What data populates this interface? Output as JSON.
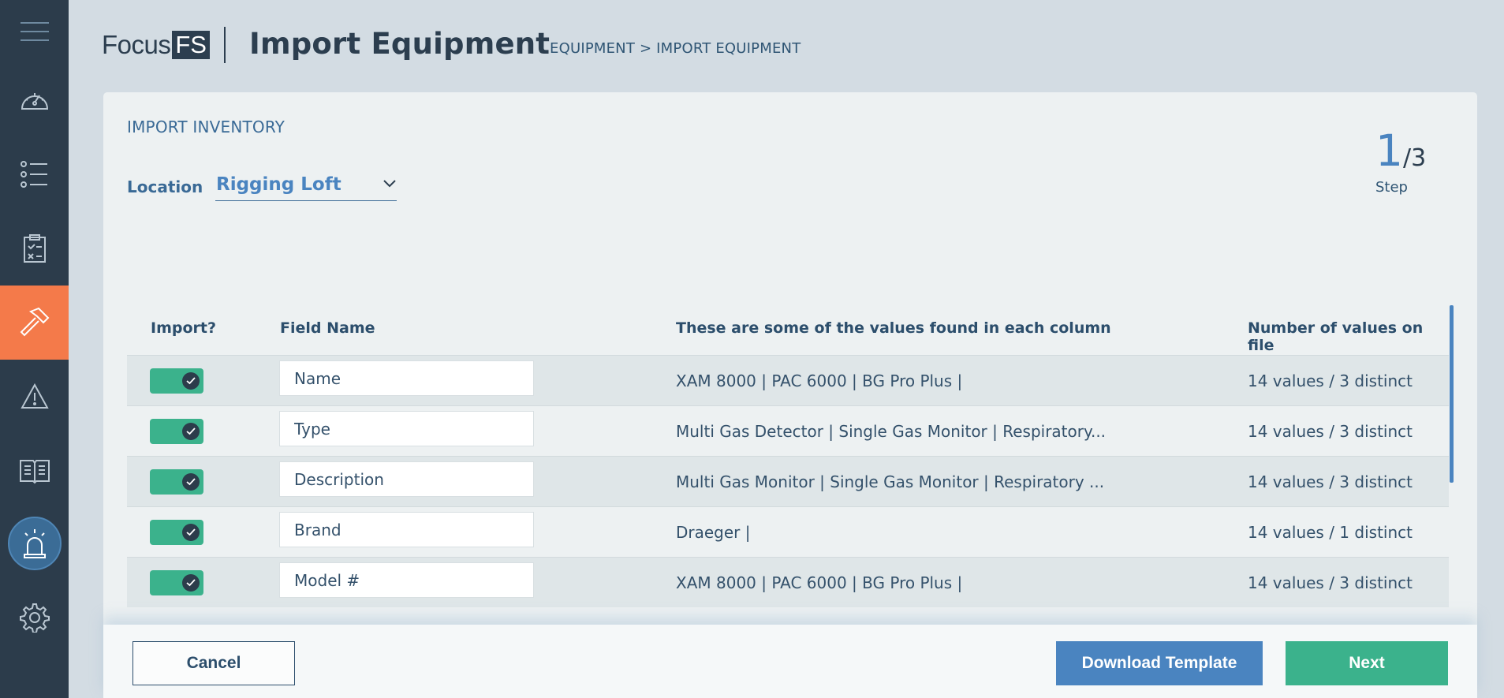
{
  "brand": {
    "focus": "Focus",
    "fs": "FS"
  },
  "header": {
    "title": "Import Equipment",
    "breadcrumb": "EQUIPMENT > IMPORT EQUIPMENT"
  },
  "sidebar": {
    "items": [
      {
        "icon": "menu-icon"
      },
      {
        "icon": "dashboard-gauge-icon"
      },
      {
        "icon": "list-icon"
      },
      {
        "icon": "checklist-clipboard-icon"
      },
      {
        "icon": "hammer-icon",
        "active": true
      },
      {
        "icon": "warning-icon"
      },
      {
        "icon": "manual-book-icon"
      },
      {
        "icon": "alarm-siren-icon"
      },
      {
        "icon": "gear-icon"
      }
    ],
    "active_color": "#f47a4a"
  },
  "section": {
    "title": "IMPORT INVENTORY",
    "location_label": "Location",
    "location_value": "Rigging Loft"
  },
  "step": {
    "current": "1",
    "total": "/3",
    "label": "Step"
  },
  "table": {
    "headers": {
      "import": "Import?",
      "field_name": "Field Name",
      "values": "These are some of the values found in each column",
      "count": "Number of values on file"
    },
    "rows": [
      {
        "import": true,
        "field": "Name",
        "values": "XAM 8000 | PAC 6000 | BG Pro Plus |",
        "count": "14 values / 3 distinct"
      },
      {
        "import": true,
        "field": "Type",
        "values": "Multi Gas Detector | Single Gas Monitor | Respiratory...",
        "count": "14 values / 3 distinct"
      },
      {
        "import": true,
        "field": "Description",
        "values": "Multi Gas Monitor | Single Gas Monitor | Respiratory ...",
        "count": "14 values / 3 distinct"
      },
      {
        "import": true,
        "field": "Brand",
        "values": "Draeger |",
        "count": "14 values / 1 distinct"
      },
      {
        "import": true,
        "field": "Model #",
        "values": "XAM 8000 | PAC 6000 | BG Pro Plus |",
        "count": "14 values / 3 distinct"
      }
    ]
  },
  "footer": {
    "cancel": "Cancel",
    "download": "Download Template",
    "next": "Next"
  },
  "colors": {
    "sidebar": "#2c3c4b",
    "accent_blue": "#4a84c0",
    "toggle_green": "#3bb28c",
    "orange": "#f47a4a"
  }
}
